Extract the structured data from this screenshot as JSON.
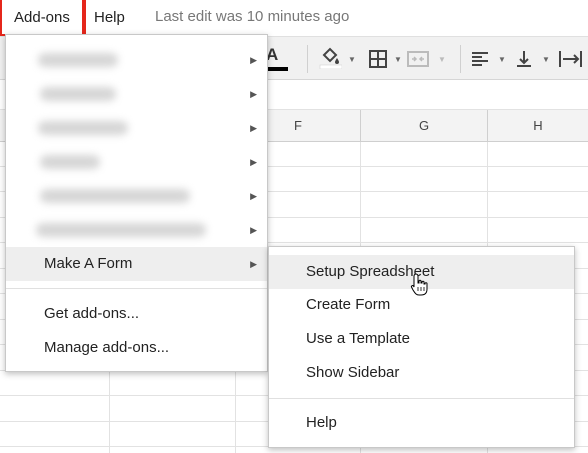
{
  "menubar": {
    "addons_label": "Add-ons",
    "help_label": "Help",
    "last_edit": "Last edit was 10 minutes ago"
  },
  "toolbar": {
    "text_color_icon": "text-color-icon",
    "fill_color_icon": "fill-color-icon",
    "borders_icon": "borders-icon",
    "merge_cells_icon": "merge-cells-icon",
    "align_left_icon": "align-left-icon",
    "valign_bottom_icon": "valign-bottom-icon",
    "text_wrap_icon": "text-wrap-icon",
    "text_color_letter": "A",
    "text_color_swatch": "#000000",
    "fill_color_swatch": "#ffffff"
  },
  "columns": [
    "F",
    "G",
    "H"
  ],
  "addons_menu": {
    "blurred_items_count_note": "",
    "make_a_form": "Make A Form",
    "get_addons": "Get add-ons...",
    "manage_addons": "Manage add-ons..."
  },
  "make_a_form_submenu": {
    "items": [
      "Setup Spreadsheet",
      "Create Form",
      "Use a Template",
      "Show Sidebar"
    ],
    "help": "Help"
  },
  "colors": {
    "highlight_box": "#e5261b",
    "menu_hover": "#eeeeee"
  }
}
